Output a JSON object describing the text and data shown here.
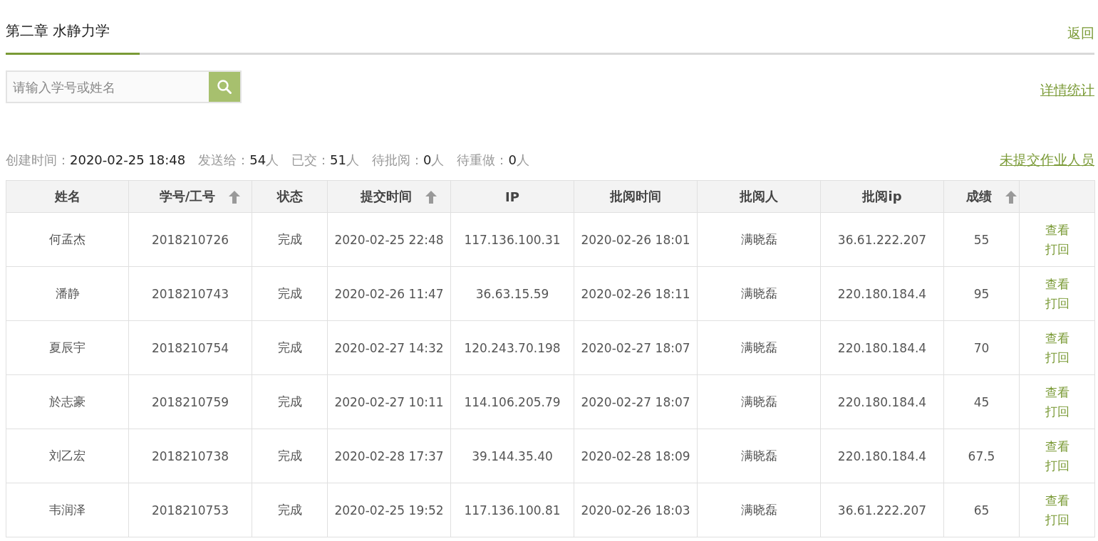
{
  "header": {
    "title": "第二章 水静力学",
    "back_link": "返回"
  },
  "search": {
    "placeholder": "请输入学号或姓名"
  },
  "detail_link": "详情统计",
  "stats": [
    {
      "label": "创建时间：",
      "value": "2020-02-25 18:48"
    },
    {
      "label": "发送给：",
      "value": "54",
      "unit": "人"
    },
    {
      "label": "已交：",
      "value": "51",
      "unit": "人"
    },
    {
      "label": "待批阅：",
      "value": "0",
      "unit": "人"
    },
    {
      "label": "待重做：",
      "value": "0",
      "unit": "人"
    }
  ],
  "unsubmitted_link": "未提交作业人员",
  "table": {
    "columns": [
      {
        "label": "姓名",
        "sortable": false
      },
      {
        "label": "学号/工号",
        "sortable": true
      },
      {
        "label": "状态",
        "sortable": false
      },
      {
        "label": "提交时间",
        "sortable": true
      },
      {
        "label": "IP",
        "sortable": false
      },
      {
        "label": "批阅时间",
        "sortable": false
      },
      {
        "label": "批阅人",
        "sortable": false
      },
      {
        "label": "批阅ip",
        "sortable": false
      },
      {
        "label": "成绩",
        "sortable": true
      }
    ],
    "rows": [
      {
        "cells": [
          "何孟杰",
          "2018210726",
          "完成",
          "2020-02-25 22:48",
          "117.136.100.31",
          "2020-02-26 18:01",
          "满晓磊",
          "36.61.222.207",
          "55"
        ],
        "actions": [
          "查看",
          "打回"
        ]
      },
      {
        "cells": [
          "潘静",
          "2018210743",
          "完成",
          "2020-02-26 11:47",
          "36.63.15.59",
          "2020-02-26 18:11",
          "满晓磊",
          "220.180.184.4",
          "95"
        ],
        "actions": [
          "查看",
          "打回"
        ]
      },
      {
        "cells": [
          "夏辰宇",
          "2018210754",
          "完成",
          "2020-02-27 14:32",
          "120.243.70.198",
          "2020-02-27 18:07",
          "满晓磊",
          "220.180.184.4",
          "70"
        ],
        "actions": [
          "查看",
          "打回"
        ]
      },
      {
        "cells": [
          "於志豪",
          "2018210759",
          "完成",
          "2020-02-27 10:11",
          "114.106.205.79",
          "2020-02-27 18:07",
          "满晓磊",
          "220.180.184.4",
          "45"
        ],
        "actions": [
          "查看",
          "打回"
        ]
      },
      {
        "cells": [
          "刘乙宏",
          "2018210738",
          "完成",
          "2020-02-28 17:37",
          "39.144.35.40",
          "2020-02-28 18:09",
          "满晓磊",
          "220.180.184.4",
          "67.5"
        ],
        "actions": [
          "查看",
          "打回"
        ]
      },
      {
        "cells": [
          "韦润泽",
          "2018210753",
          "完成",
          "2020-02-25 19:52",
          "117.136.100.81",
          "2020-02-26 18:03",
          "满晓磊",
          "36.61.222.207",
          "65"
        ],
        "actions": [
          "查看",
          "打回"
        ]
      }
    ]
  }
}
